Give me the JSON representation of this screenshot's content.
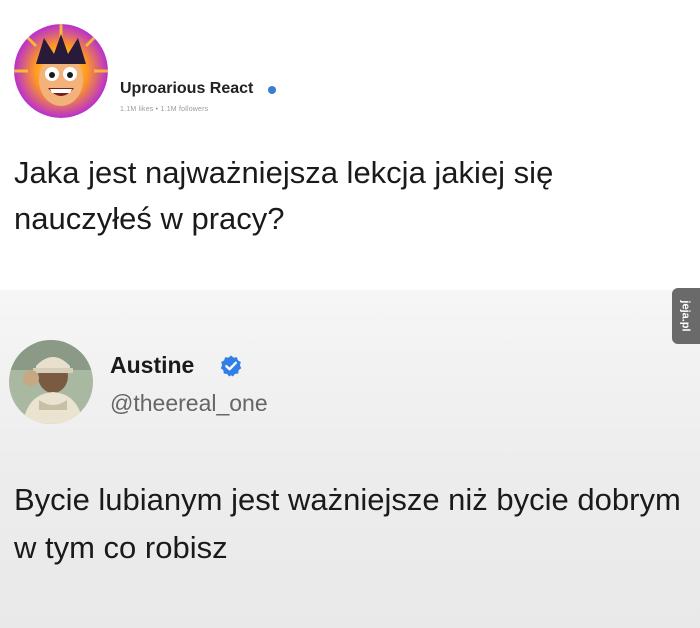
{
  "post_top": {
    "author_name": "Uproarious React",
    "author_stats": "1.1M likes • 1.1M followers",
    "text": "Jaka jest najważniejsza lekcja jakiej się nauczyłeś w pracy?"
  },
  "post_bottom": {
    "author_name": "Austine",
    "author_handle": "@theereal_one",
    "text": "Bycie lubianym jest ważniejsze niż bycie dobrym w tym co robisz"
  },
  "watermark": {
    "text": "jeja.pl"
  },
  "colors": {
    "verified": "#2f7fe6",
    "top_badge": "#3a7bd5",
    "watermark_bg": "#6a6a6a"
  },
  "icons": {
    "verified": "verified-badge-icon",
    "top_badge": "verified-dot-icon"
  }
}
